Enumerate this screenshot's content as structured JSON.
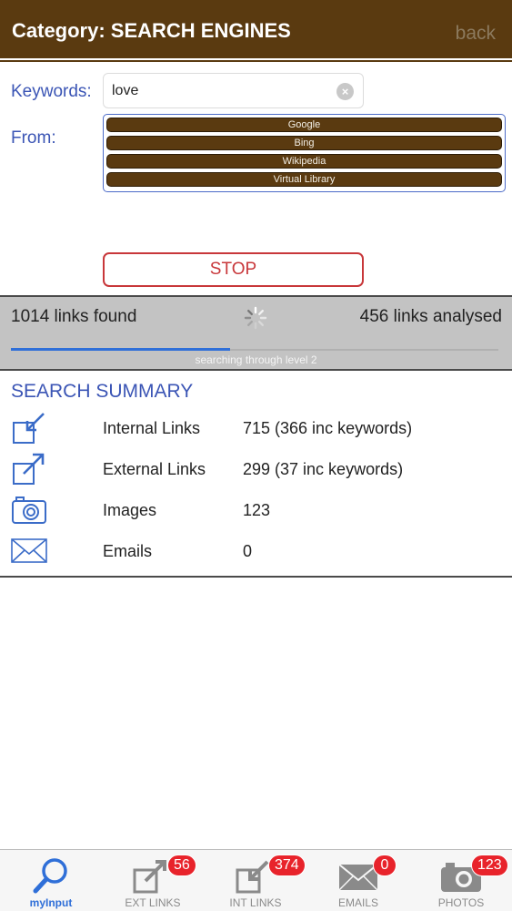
{
  "header": {
    "title": "Category: SEARCH ENGINES",
    "back_label": "back"
  },
  "form": {
    "keywords_label": "Keywords:",
    "keywords_value": "love",
    "from_label": "From:",
    "engines": [
      "Google",
      "Bing",
      "Wikipedia",
      "Virtual Library"
    ],
    "stop_label": "STOP"
  },
  "status": {
    "links_found": "1014 links found",
    "links_analysed": "456 links analysed",
    "level_text": "searching through level 2",
    "progress_fraction": 0.45
  },
  "summary": {
    "title": "SEARCH SUMMARY",
    "rows": [
      {
        "icon": "internal-link-icon",
        "label": "Internal Links",
        "value": "715 (366 inc keywords)"
      },
      {
        "icon": "external-link-icon",
        "label": "External Links",
        "value": "299 (37 inc keywords)"
      },
      {
        "icon": "camera-icon",
        "label": "Images",
        "value": "123"
      },
      {
        "icon": "envelope-icon",
        "label": "Emails",
        "value": "0"
      }
    ]
  },
  "tabs": [
    {
      "label": "myInput",
      "icon": "magnifier-icon",
      "active": true
    },
    {
      "label": "EXT LINKS",
      "icon": "external-link-icon",
      "badge": "56"
    },
    {
      "label": "INT LINKS",
      "icon": "internal-link-icon",
      "badge": "374"
    },
    {
      "label": "EMAILS",
      "icon": "envelope-icon",
      "badge": "0"
    },
    {
      "label": "PHOTOS",
      "icon": "camera-icon",
      "badge": "123"
    }
  ],
  "colors": {
    "brand": "#5a3a10",
    "accent_blue": "#3b55b5",
    "stop_red": "#c8373a",
    "badge_red": "#e8232b"
  }
}
